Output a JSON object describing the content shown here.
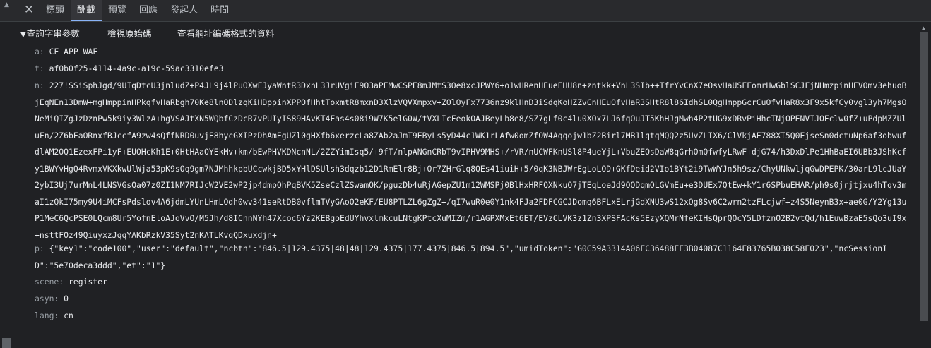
{
  "tabs": {
    "close_glyph": "✕",
    "items": [
      {
        "label": "標頭"
      },
      {
        "label": "酬載"
      },
      {
        "label": "預覽"
      },
      {
        "label": "回應"
      },
      {
        "label": "發起人"
      },
      {
        "label": "時間"
      }
    ],
    "active_index": 1
  },
  "toolbar": {
    "caret": "▼",
    "query_params": "查詢字串參數",
    "view_source": "檢視原始碼",
    "view_url_encoded": "查看網址編碼格式的資料"
  },
  "params": {
    "a": {
      "key": "a:",
      "value": "CF_APP_WAF"
    },
    "t": {
      "key": "t:",
      "value": "af0b0f25-4114-4a9c-a19c-59ac3310efe3"
    },
    "n": {
      "key": "n:",
      "value": "227!SSiSphJgd/9UIqDtcU3jnludZ+P4JL9j4lPuOXwFJyaWntR3DxnL3JrUVgiE9O3aPEMwCSPE8mJMtS3Oe8xcJPWY6+o1wHRenHEueEHU8n+zntkk+VnL3SIb++TfrYvCnX7eOsvHaUSFFomrHwGblSCJFjNHmzpinHEVOmv3ehuoBjEqNEn13DmW+mgHmppinHPkqfvHaRbgh70Ke8lnODlzqKiHDppinXPPOfHhtToxmtR8mxnD3XlzVQVXmpxv+ZOlOyFx7736nz9klHnD3iSdqKoHZZvCnHEuOfvHaR3SHtR8l86IdhSL0QgHmppGcrCuOfvHaR8x3F9x5kfCy0vgl3yh7MgsONeMiQIZgJzDznPw5k9iy3WlzA+hgVSAJtXN5WQbfCzDcR7vPUIyIS89HAvKT4Fas4s08i9W7K5elG0W/tVXLIcFeokOAJBeyLb8e8/SZ7gLf0c4lu0XOx7LJ6fqOuJT5KhHJgMwh4P2tUG9xDRvPiHhcTNjOPENVIJOFclw0fZ+uPdpMZZUluFn/2Z6bEaORnxfBJccfA9zw4sQffNRD0uvjE8hycGXIPzDhAmEgUZl0gHXfb6xerzcLa8ZAb2aJmT9EByLs5yD44c1WK1rLAfw0omZfOW4Aqqojw1bZ2Birl7MB1lqtqMQQ2z5UvZLIX6/ClVkjAE788XT5Q0EjseSn0dctuNp6af3obwufdlAM2OQ1EzexFPi1yF+EUOHcKh1E+0HtHAaOYEkMv+km/bEwPHVKDNcnNL/2ZZYimIsq5/+9fT/nlpANGnCRbT9vIPHV9MHS+/rVR/nUCWFKnUSl8P4ueYjL+VbuZEOsDaW8qGrhOmQfwfyLRwF+djG74/h3DxDlPe1HhBaEI6UBb3JShKcfy1BWYvHgQ4RvmxVKXkwUlWja53pK9sOq9gm7NJMhhkpbUCcwkjBD5xYHlDSUlsh3dqzb12D1RmElr8Bj+Or7ZHrGlq8QEs41iuiH+5/0qK3NBJWrEgLoLOD+GKfDeid2VIo1BYt2i9TwWYJn5h9sz/ChyUNkwljqGwDPEPK/30arL9lcJUaY2ybI3Uj7urMnL4LNSVGsQa07z0ZI1NM7RIJcW2VE2wP2jp4dmpQhPqBVK5ZseCzlZSwamOK/pguzDb4uRjAGepZU1m12WMSPj0BlHxHRFQXNkuQ7jTEqLoeJd9OQDqmOLGVmEu+e3DUEx7QtEw+kY1r6SPbuEHAR/ph9s0jrjtjxu4hTqv3maI1zQkI75my9U4iMCFsPdslov4A6jdmLYUnLHmLOdh0wv341seRtDB0vflmTVyGAoO2eKF/EU8PTLZL6gZgZ+/qI7wuR0e0Y1nk4FJa2FDFCGCJDomq6BFLxELrjGdXNU3wS12xQg8Sv6C2wrn2tzFLcjwf+z4S5NeynB3x+ae0G/Y2Yg13uP1MeC6QcPSE0LQcm8Ur5YofnEloAJoVvO/M5Jh/d8ICnnNYh47Xcoc6Yz2KEBgoEdUYhvxlmkcuLNtgKPtcXuMIZm/r1AGPXMxEt6ET/EVzCLVK3z1Zn3XPSFAcKs5EzyXQMrNfeKIHsQprQOcY5LDfznO2B2vtQd/h1EuwBzaE5sQo3uI9x+nsttFOz49QiuyxzJqqYAKbRzkV35Syt2nKATLKvqQDxuxdjn+"
    },
    "p": {
      "key": "p:",
      "value": "{\"key1\":\"code100\",\"user\":\"default\",\"ncbtn\":\"846.5|129.4375|48|48|129.4375|177.4375|846.5|894.5\",\"umidToken\":\"G0C59A3314A06FC36488FF3B04087C1164F83765B038C58E023\",\"ncSessionID\":\"5e70deca3ddd\",\"et\":\"1\"}"
    },
    "scene": {
      "key": "scene:",
      "value": "register"
    },
    "asyn": {
      "key": "asyn:",
      "value": "0"
    },
    "lang": {
      "key": "lang:",
      "value": "cn"
    }
  },
  "colors": {
    "accent": "#8ab4f8",
    "background": "#202124",
    "key": "#9aa0a6"
  }
}
